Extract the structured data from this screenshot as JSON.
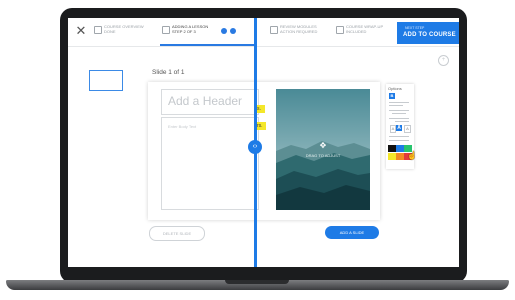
{
  "topbar": {
    "steps": [
      {
        "label": "COURSE OVERVIEW",
        "sub": "DONE"
      },
      {
        "label": "ADDING A LESSON",
        "sub": "STEP 2 OF 3"
      },
      {
        "label": "REVIEW MODULES",
        "sub": "ACTION REQUIRED"
      },
      {
        "label": "COURSE WRAP-UP",
        "sub": "INCLUDED"
      }
    ],
    "cta_small": "NEXT STEP",
    "cta_label": "ADD TO COURSE"
  },
  "editor": {
    "slide_title": "Slide 1 of 1",
    "header_placeholder": "Add a Header",
    "body_placeholder": "Enter Body Text",
    "image_label": "DRAG TO ADJUST"
  },
  "options_panel": {
    "title": "Options",
    "bold_label": "B",
    "font_small": "A",
    "font_medium": "A",
    "font_large": "A",
    "swatches": [
      "#111111",
      "#1e7be6",
      "#27c46d",
      "#f4e72a",
      "#f28b24",
      "#e23b3b"
    ]
  },
  "footer": {
    "delete_label": "DELETE SLIDE",
    "add_label": "ADD A SLIDE"
  },
  "colors": {
    "accent": "#1e7be6",
    "highlight": "#f4e72a"
  }
}
